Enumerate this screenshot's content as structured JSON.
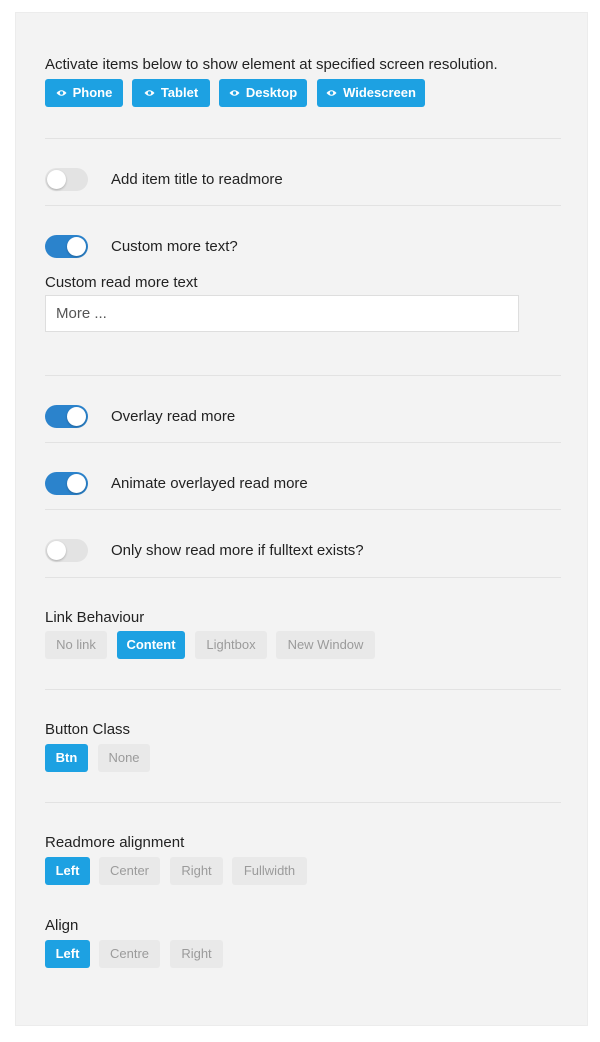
{
  "responsive": {
    "intro": "Activate items below to show element at specified screen resolution.",
    "buttons": [
      {
        "label": "Phone",
        "icon": "eye-icon"
      },
      {
        "label": "Tablet",
        "icon": "eye-icon"
      },
      {
        "label": "Desktop",
        "icon": "eye-icon"
      },
      {
        "label": "Widescreen",
        "icon": "eye-icon"
      }
    ]
  },
  "toggles": {
    "item_title": {
      "label": "Add item title to readmore",
      "on": false
    },
    "custom_more": {
      "label": "Custom more text?",
      "on": true
    },
    "overlay": {
      "label": "Overlay read more",
      "on": true
    },
    "animate": {
      "label": "Animate overlayed read more",
      "on": true
    },
    "fulltext": {
      "label": "Only show read more if fulltext exists?",
      "on": false
    }
  },
  "custom_text": {
    "label": "Custom read more text",
    "value": "More ..."
  },
  "link_behaviour": {
    "label": "Link Behaviour",
    "options": [
      "No link",
      "Content",
      "Lightbox",
      "New Window"
    ],
    "selected": "Content"
  },
  "button_class": {
    "label": "Button Class",
    "options": [
      "Btn",
      "None"
    ],
    "selected": "Btn"
  },
  "readmore_alignment": {
    "label": "Readmore alignment",
    "options": [
      "Left",
      "Center",
      "Right",
      "Fullwidth"
    ],
    "selected": "Left"
  },
  "align": {
    "label": "Align",
    "options": [
      "Left",
      "Centre",
      "Right"
    ],
    "selected": "Left"
  },
  "colors": {
    "accent": "#1da1e2",
    "toggle_on": "#2b83cc",
    "toggle_off": "#e3e3e3",
    "panel_bg": "#f3f3f3"
  }
}
